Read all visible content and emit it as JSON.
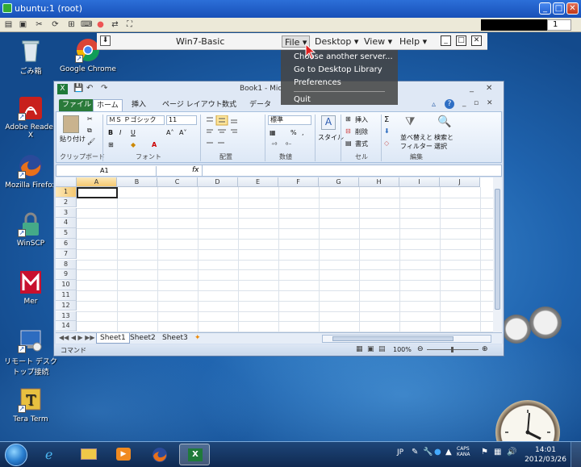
{
  "outer_window": {
    "title": "ubuntu:1 (root)"
  },
  "vnc_toolbar": {
    "status_number": "1"
  },
  "desktop_icons": [
    {
      "label": "ごみ箱",
      "icon": "recycle-bin-icon"
    },
    {
      "label": "Google Chrome",
      "icon": "chrome-icon"
    },
    {
      "label": "Adobe Reader X",
      "icon": "adobe-reader-icon"
    },
    {
      "label": "Mozilla Firefox",
      "icon": "firefox-icon"
    },
    {
      "label": "WinSCP",
      "icon": "winscp-icon"
    },
    {
      "label": "Mer",
      "icon": "mcafee-icon"
    },
    {
      "label": "リモート デスク",
      "label2": "トップ接続",
      "icon": "remote-desktop-icon"
    },
    {
      "label": "Tera Term",
      "icon": "teraterm-icon"
    }
  ],
  "nx_bar": {
    "title": "Win7-Basic",
    "menus": [
      "File ▾",
      "Desktop ▾",
      "View ▾",
      "Help ▾"
    ],
    "file_menu_items": [
      "Choose another server...",
      "Go to Desktop Library",
      "Preferences",
      "Quit"
    ]
  },
  "excel": {
    "title": "Book1 - Mic",
    "tabs": [
      "ファイル",
      "ホーム",
      "挿入",
      "ページ レイアウト",
      "数式",
      "データ"
    ],
    "ribbon": {
      "paste": "貼り付け",
      "clipboard": "クリップボード",
      "font_name": "ＭＳ Ｐゴシック",
      "font_size": "11",
      "font_group": "フォント",
      "alignment_group": "配置",
      "number_format": "標準",
      "number_group": "数値",
      "style": "スタイル",
      "insert": "挿入",
      "delete": "削除",
      "format": "書式",
      "cells_group": "セル",
      "sort_filter_1": "並べ替えと",
      "sort_filter_2": "フィルター",
      "find_select_1": "検索と",
      "find_select_2": "選択",
      "editing_group": "編集"
    },
    "name_box": "A1",
    "fx": "fx",
    "columns": [
      "A",
      "B",
      "C",
      "D",
      "E",
      "F",
      "G",
      "H",
      "I",
      "J"
    ],
    "rows": [
      "1",
      "2",
      "3",
      "4",
      "5",
      "6",
      "7",
      "8",
      "9",
      "10",
      "11",
      "12",
      "13",
      "14"
    ],
    "sheets": [
      "Sheet1",
      "Sheet2",
      "Sheet3"
    ],
    "status_mode": "コマンド",
    "zoom": "100%"
  },
  "tray": {
    "ime": "JP",
    "time": "14:01",
    "date": "2012/03/26"
  }
}
